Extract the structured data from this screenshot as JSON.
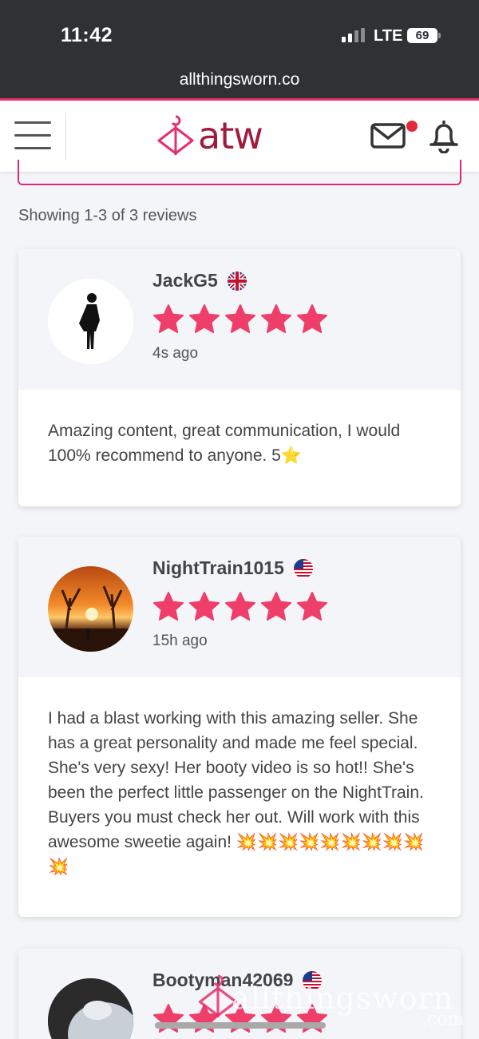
{
  "status_bar": {
    "time": "11:42",
    "network": "LTE",
    "battery": "69"
  },
  "browser": {
    "url": "allthingsworn.co"
  },
  "header": {
    "logo_text": "atw"
  },
  "reviews_summary": "Showing 1-3 of 3 reviews",
  "reviews": [
    {
      "username": "JackG5",
      "flag": "uk-flag-icon",
      "rating": 5,
      "time_ago": "4s ago",
      "text": "Amazing content, great communication, I would 100% recommend to anyone. 5⭐"
    },
    {
      "username": "NightTrain1015",
      "flag": "us-flag-icon",
      "rating": 5,
      "time_ago": "15h ago",
      "text": "I had a blast working with this amazing seller. She has a great personality and made me feel special. She's very sexy! Her booty video is so hot!! She's been the perfect little passenger on the NightTrain. Buyers you must check her out. Will work with this awesome sweetie again! 💥💥💥💥💥💥💥💥💥💥"
    },
    {
      "username": "Bootyman42069",
      "flag": "us-flag-icon",
      "rating": 5
    }
  ],
  "watermark": {
    "text": "allthingsworn",
    "sub": ".com"
  },
  "colors": {
    "accent": "#e5306c",
    "brand": "#a11b3c",
    "star": "#ef3e6a"
  }
}
